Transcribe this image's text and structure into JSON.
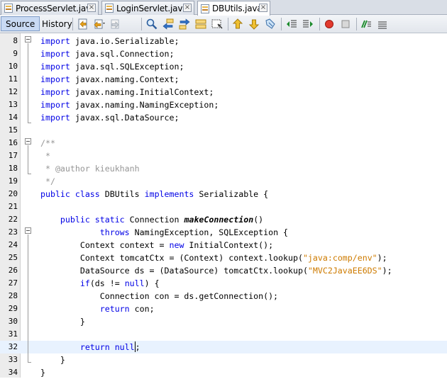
{
  "tabs": [
    {
      "label": "ProcessServlet.java",
      "active": false
    },
    {
      "label": "LoginServlet.java",
      "active": false
    },
    {
      "label": "DBUtils.java",
      "active": true
    }
  ],
  "toolbar": {
    "source_label": "Source",
    "history_label": "History",
    "icons": [
      "last-edit-icon",
      "back-icon",
      "forward-icon",
      "find-icon",
      "find-previous-icon",
      "find-next-icon",
      "toggle-highlight-icon",
      "find-selection-icon",
      "previous-bookmark-icon",
      "next-bookmark-icon",
      "toggle-bookmark-icon",
      "shift-left-icon",
      "shift-right-icon",
      "start-macro-icon",
      "stop-macro-icon",
      "comment-icon",
      "uncomment-icon"
    ]
  },
  "editor": {
    "lines": [
      {
        "num": "8",
        "tokens": [
          [
            "kw",
            "import"
          ],
          [
            "",
            "java.io.Serializable;"
          ]
        ]
      },
      {
        "num": "9",
        "tokens": [
          [
            "kw",
            "import"
          ],
          [
            "",
            "java.sql.Connection;"
          ]
        ]
      },
      {
        "num": "10",
        "tokens": [
          [
            "kw",
            "import"
          ],
          [
            "",
            "java.sql.SQLException;"
          ]
        ]
      },
      {
        "num": "11",
        "tokens": [
          [
            "kw",
            "import"
          ],
          [
            "",
            "javax.naming.Context;"
          ]
        ]
      },
      {
        "num": "12",
        "tokens": [
          [
            "kw",
            "import"
          ],
          [
            "",
            "javax.naming.InitialContext;"
          ]
        ]
      },
      {
        "num": "13",
        "tokens": [
          [
            "kw",
            "import"
          ],
          [
            "",
            "javax.naming.NamingException;"
          ]
        ]
      },
      {
        "num": "14",
        "tokens": [
          [
            "kw",
            "import"
          ],
          [
            "",
            "javax.sql.DataSource;"
          ]
        ]
      },
      {
        "num": "15",
        "tokens": []
      },
      {
        "num": "16",
        "tokens": [
          [
            "cmt",
            "/**"
          ]
        ]
      },
      {
        "num": "17",
        "tokens": [
          [
            "cmt",
            " *"
          ]
        ]
      },
      {
        "num": "18",
        "tokens": [
          [
            "cmt",
            " * @author kieukhanh"
          ]
        ]
      },
      {
        "num": "19",
        "tokens": [
          [
            "cmt",
            " */"
          ]
        ]
      },
      {
        "num": "20",
        "tokens": [
          [
            "kw",
            "public class"
          ],
          [
            "",
            "DBUtils"
          ],
          [
            "kw",
            "implements"
          ],
          [
            "",
            "Serializable {"
          ]
        ]
      },
      {
        "num": "21",
        "tokens": []
      },
      {
        "num": "22",
        "tokens": [
          [
            "",
            "    "
          ],
          [
            "kw",
            "public static"
          ],
          [
            "",
            "Connection"
          ],
          [
            "mth",
            "makeConnection"
          ],
          [
            "",
            "()"
          ]
        ]
      },
      {
        "num": "23",
        "tokens": [
          [
            "",
            "            "
          ],
          [
            "kw",
            "throws"
          ],
          [
            "",
            "NamingException, SQLException {"
          ]
        ]
      },
      {
        "num": "24",
        "tokens": [
          [
            "",
            "        Context context = "
          ],
          [
            "kw",
            "new"
          ],
          [
            "",
            "InitialContext();"
          ]
        ]
      },
      {
        "num": "25",
        "tokens": [
          [
            "",
            "        Context tomcatCtx = (Context) context.lookup("
          ],
          [
            "str",
            "\"java:comp/env\""
          ],
          [
            "",
            ");"
          ]
        ]
      },
      {
        "num": "26",
        "tokens": [
          [
            "",
            "        DataSource ds = (DataSource) tomcatCtx.lookup("
          ],
          [
            "str",
            "\"MVC2JavaEE6DS\""
          ],
          [
            "",
            ");"
          ]
        ]
      },
      {
        "num": "27",
        "tokens": [
          [
            "",
            "        "
          ],
          [
            "kw",
            "if"
          ],
          [
            "",
            "(ds != "
          ],
          [
            "kw",
            "null"
          ],
          [
            "",
            ") {"
          ]
        ]
      },
      {
        "num": "28",
        "tokens": [
          [
            "",
            "            Connection con = ds.getConnection();"
          ]
        ]
      },
      {
        "num": "29",
        "tokens": [
          [
            "",
            "            "
          ],
          [
            "kw",
            "return"
          ],
          [
            "",
            "con;"
          ]
        ]
      },
      {
        "num": "30",
        "tokens": [
          [
            "",
            "        }"
          ]
        ]
      },
      {
        "num": "31",
        "tokens": []
      },
      {
        "num": "32",
        "tokens": [
          [
            "",
            "        "
          ],
          [
            "kw",
            "return null"
          ],
          [
            "",
            ";"
          ]
        ]
      },
      {
        "num": "33",
        "tokens": [
          [
            "",
            "    }"
          ]
        ]
      },
      {
        "num": "34",
        "tokens": [
          [
            "",
            "}"
          ]
        ]
      }
    ],
    "current_line": "32"
  }
}
